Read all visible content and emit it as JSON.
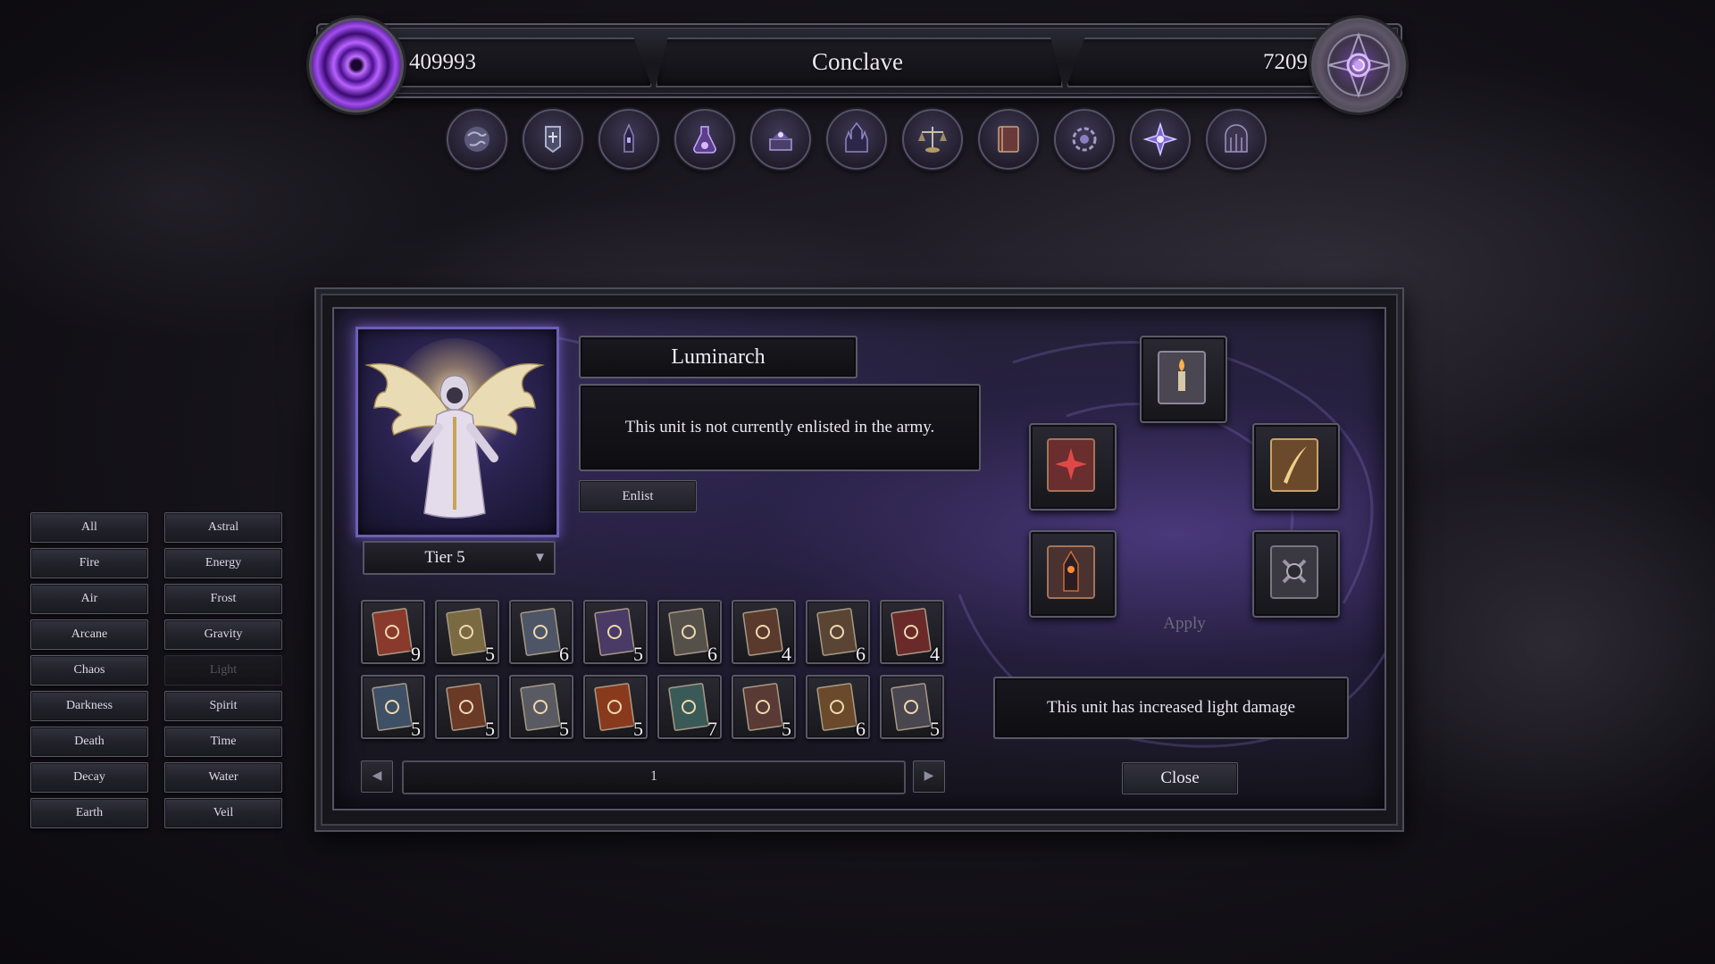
{
  "header": {
    "currency_left": "409993",
    "title": "Conclave",
    "currency_right": "7209"
  },
  "nav": {
    "icons": [
      "world-map-icon",
      "army-banner-icon",
      "dark-tower-icon",
      "alchemy-flask-icon",
      "enchanting-altar-icon",
      "castle-spires-icon",
      "merchant-scales-icon",
      "spellbook-icon",
      "sigil-gear-icon",
      "arcane-star-icon",
      "dungeon-gate-icon"
    ]
  },
  "filters": {
    "left": [
      "All",
      "Fire",
      "Air",
      "Arcane",
      "Chaos",
      "Darkness",
      "Death",
      "Decay",
      "Earth"
    ],
    "right": [
      "Astral",
      "Energy",
      "Frost",
      "Gravity",
      "Light",
      "Spirit",
      "Time",
      "Water",
      "Veil"
    ],
    "disabled": [
      "Light"
    ]
  },
  "unit": {
    "name": "Luminarch",
    "status": "This unit is not currently enlisted in the army.",
    "enlist_label": "Enlist",
    "tier": "Tier 5",
    "effect": "This unit has increased light damage"
  },
  "books": [
    {
      "icon": "swirl-book-icon",
      "color": "#8a3a2c",
      "count": "9"
    },
    {
      "icon": "lightning-book-icon",
      "color": "#7a6a42",
      "count": "5"
    },
    {
      "icon": "sun-book-icon",
      "color": "#4d5566",
      "count": "6"
    },
    {
      "icon": "eye-book-icon",
      "color": "#4a3a66",
      "count": "5"
    },
    {
      "icon": "lightning-book-icon",
      "color": "#55504a",
      "count": "6"
    },
    {
      "icon": "tower-book-icon",
      "color": "#5a3a2c",
      "count": "4"
    },
    {
      "icon": "star-book-icon",
      "color": "#5a4434",
      "count": "6"
    },
    {
      "icon": "red-star-book-icon",
      "color": "#6a2a2a",
      "count": "4"
    },
    {
      "icon": "frost-book-icon",
      "color": "#3d5066",
      "count": "5"
    },
    {
      "icon": "ember-book-icon",
      "color": "#6a3a26",
      "count": "5"
    },
    {
      "icon": "radiant-book-icon",
      "color": "#5a5a62",
      "count": "5"
    },
    {
      "icon": "flame-book-icon",
      "color": "#8a3a1c",
      "count": "5"
    },
    {
      "icon": "teal-star-book-icon",
      "color": "#3a5a58",
      "count": "7"
    },
    {
      "icon": "ring-book-icon",
      "color": "#5a3a34",
      "count": "5"
    },
    {
      "icon": "quill-book-icon",
      "color": "#6a4a2a",
      "count": "6"
    },
    {
      "icon": "candle-book-icon",
      "color": "#4a4650",
      "count": "5"
    }
  ],
  "pager": {
    "page": "1"
  },
  "rune_slots": [
    "candle-tome-icon",
    "red-star-tome-icon",
    "golden-quill-tome-icon",
    "tower-tome-icon",
    "dark-sigil-tome-icon"
  ],
  "apply_label": "Apply",
  "close_label": "Close"
}
